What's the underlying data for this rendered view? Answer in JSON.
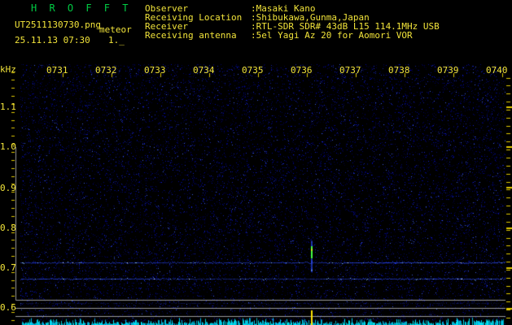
{
  "app": {
    "title": "H R O F F T"
  },
  "header": {
    "filename": "UT2511130730.png",
    "mode_label": "meteor",
    "datetime": "25.11.13 07:30",
    "counter": "1._",
    "info_rows": [
      {
        "label": "Observer",
        "value": ":Masaki Kano"
      },
      {
        "label": "Receiving Location",
        "value": ":Shibukawa,Gunma,Japan"
      },
      {
        "label": "Receiver",
        "value": ":RTL-SDR SDR# 43dB L15 114.1MHz USB"
      },
      {
        "label": "Receiving antenna",
        "value": ":5el Yagi Az 20 for Aomori VOR"
      }
    ]
  },
  "spectrogram": {
    "freq_axis": {
      "unit": "kHz",
      "tick_labels": [
        "1.1",
        "1.0",
        "0.9",
        "0.8",
        "0.7",
        "0.6"
      ]
    },
    "time_axis": {
      "tick_labels": [
        "0731",
        "0732",
        "0733",
        "0734",
        "0735",
        "0736",
        "0737",
        "0738",
        "0739",
        "0740"
      ]
    },
    "features": {
      "carrier_lines_khz": [
        0.71,
        0.67,
        0.615
      ],
      "meteor_echo": {
        "time": "0736.5",
        "freq_khz": 0.71
      },
      "level_spike_time": "0736.5"
    },
    "colors": {
      "background": "#000000",
      "title_green": "#00cc44",
      "label_yellow": "#f2e43a",
      "tick_yellow": "#e0c800",
      "noise_blue": "#1020a0",
      "carrier_blue": "#2a50ff",
      "echo_green": "#44ff44",
      "level_cyan": "#00e0f0",
      "grid_gray": "#9a9a9a"
    }
  }
}
